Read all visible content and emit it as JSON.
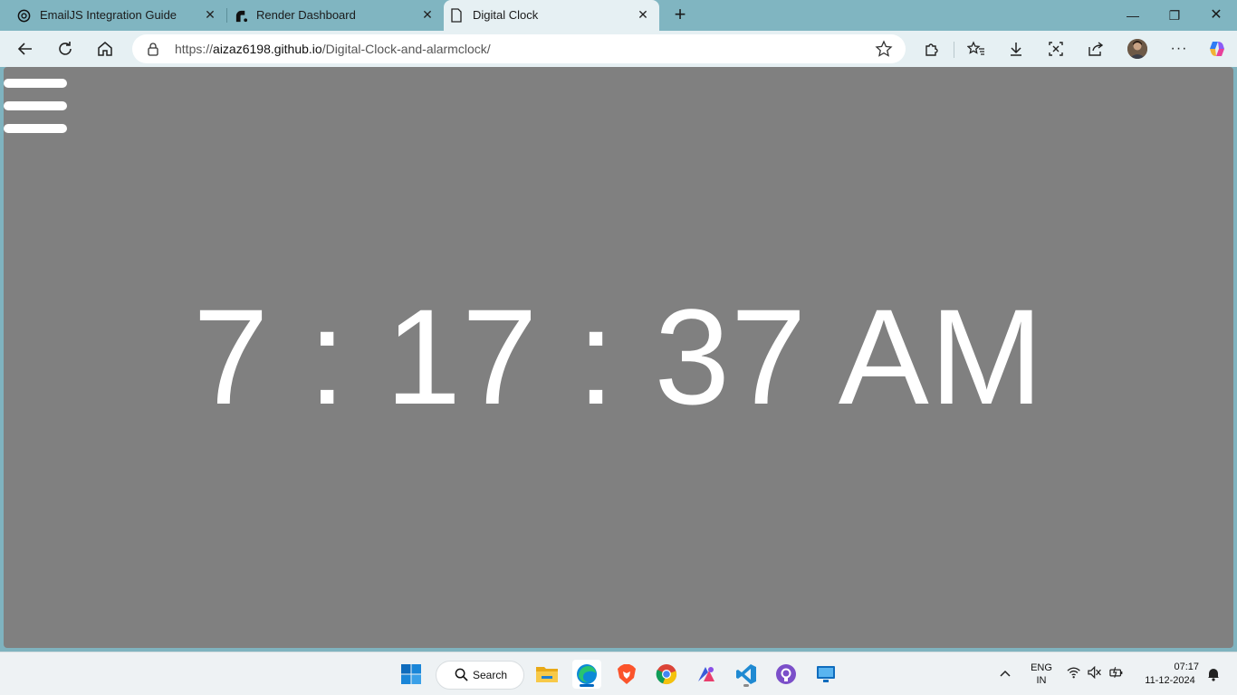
{
  "browser": {
    "tabs": [
      {
        "title": "EmailJS Integration Guide",
        "icon": "openai-icon",
        "active": false
      },
      {
        "title": "Render Dashboard",
        "icon": "render-icon",
        "active": false
      },
      {
        "title": "Digital Clock",
        "icon": "page-icon",
        "active": true
      }
    ],
    "address_bar": {
      "url_prefix": "https://",
      "url_host": "aizaz6198.github.io",
      "url_path": "/Digital-Clock-and-alarmclock/"
    }
  },
  "page": {
    "menu_icon": "hamburger-menu-icon",
    "clock": {
      "time_text": "7 : 17 : 37 AM"
    }
  },
  "taskbar": {
    "search_label": "Search",
    "apps": [
      "start-icon",
      "file-explorer-icon",
      "edge-icon",
      "brave-icon",
      "chrome-icon",
      "app-icon",
      "vscode-icon",
      "github-desktop-icon",
      "remote-desktop-icon"
    ],
    "language_line1": "ENG",
    "language_line2": "IN",
    "time": "07:17",
    "date": "11-12-2024"
  },
  "colors": {
    "page_background": "#808080",
    "clock_text": "#ffffff",
    "browser_frame": "#80b5c1"
  }
}
